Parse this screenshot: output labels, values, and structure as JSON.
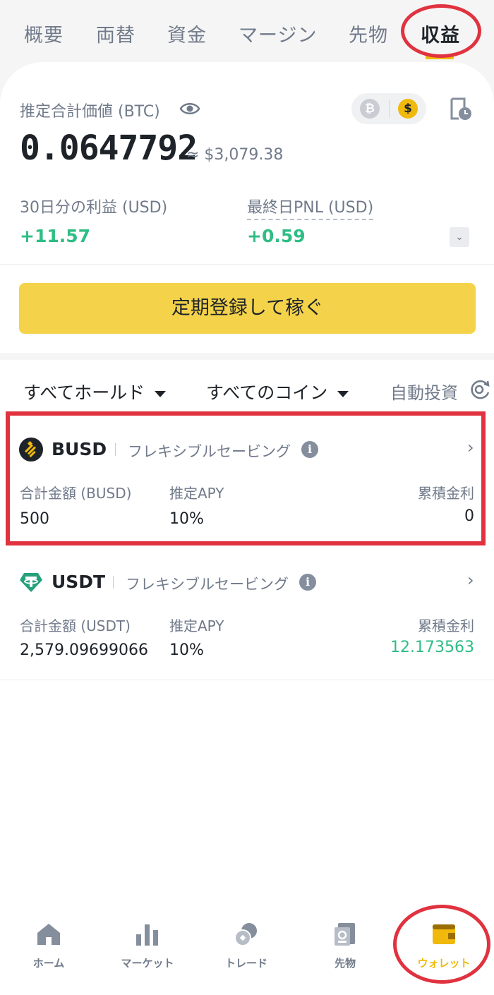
{
  "tabs": [
    {
      "label": "概要"
    },
    {
      "label": "両替"
    },
    {
      "label": "資金"
    },
    {
      "label": "マージン"
    },
    {
      "label": "先物"
    },
    {
      "label": "収益"
    }
  ],
  "summary": {
    "est_label": "推定合計価値 (BTC)",
    "toggle_btc": "₿",
    "toggle_usd": "$",
    "balance": "0.0647792",
    "approx": "≈ $3,079.38",
    "profit30_label": "30日分の利益 (USD)",
    "profit30_value": "+11.57",
    "pnl_label": "最終日PNL (USD)",
    "pnl_value": "+0.59",
    "expand": "⌄",
    "subscribe_button": "定期登録して稼ぐ"
  },
  "filters": {
    "hold": "すべてホールド",
    "coins": "すべてのコイン",
    "auto_invest": "自動投資"
  },
  "items": [
    {
      "symbol": "BUSD",
      "type": "フレキシブルセービング",
      "amount_label": "合計金額 (BUSD)",
      "amount": "500",
      "apy_label": "推定APY",
      "apy": "10%",
      "interest_label": "累積金利",
      "interest": "0"
    },
    {
      "symbol": "USDT",
      "type": "フレキシブルセービング",
      "amount_label": "合計金額 (USDT)",
      "amount": "2,579.09699066",
      "apy_label": "推定APY",
      "apy": "10%",
      "interest_label": "累積金利",
      "interest": "12.173563"
    }
  ],
  "info_glyph": "i",
  "chevron": "›",
  "nav": [
    {
      "label": "ホーム"
    },
    {
      "label": "マーケット"
    },
    {
      "label": "トレード"
    },
    {
      "label": "先物"
    },
    {
      "label": "ウォレット"
    }
  ],
  "colors": {
    "accent": "#f0b90b",
    "positive": "#2ebd85",
    "highlight": "#e0323f"
  }
}
